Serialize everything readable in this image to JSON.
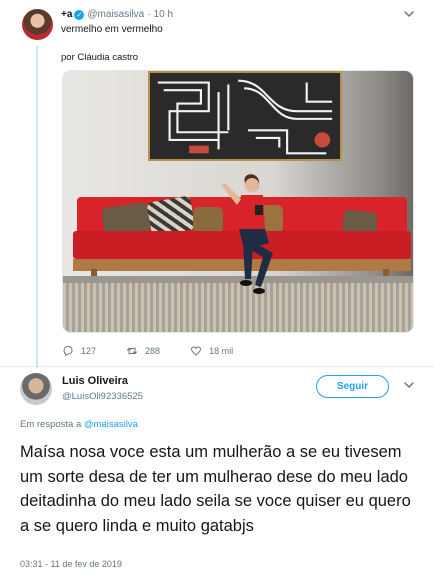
{
  "parent_tweet": {
    "display_name": "+a",
    "handle": "@maisasilva",
    "time": "10 h",
    "separator": "·",
    "text": "vermelho em vermelho",
    "credit": "por Cláudia castro",
    "actions": {
      "replies": "127",
      "retweets": "288",
      "likes": "18 mil"
    }
  },
  "reply_tweet": {
    "display_name": "Luis Oliveira",
    "handle": "@LuisOli92336525",
    "follow_label": "Seguir",
    "reply_prefix": "Em resposta a",
    "reply_mention": "@maisasilva",
    "text": "Maísa  nosa voce esta um mulherão a se eu tivesem um sorte desa de ter um mulherao dese do meu lado deitadinha do meu lado seila se voce quiser eu quero a se quero linda e muito gatabjs",
    "timestamp": "03:31 - 11 de fev de 2019"
  },
  "colors": {
    "accent": "#1da1f2",
    "muted": "#657786",
    "thread_line": "#cbe3f5",
    "sofa": "#d8232a"
  },
  "icons": [
    "verified-badge-icon",
    "chevron-down-icon",
    "reply-icon",
    "retweet-icon",
    "like-icon"
  ]
}
